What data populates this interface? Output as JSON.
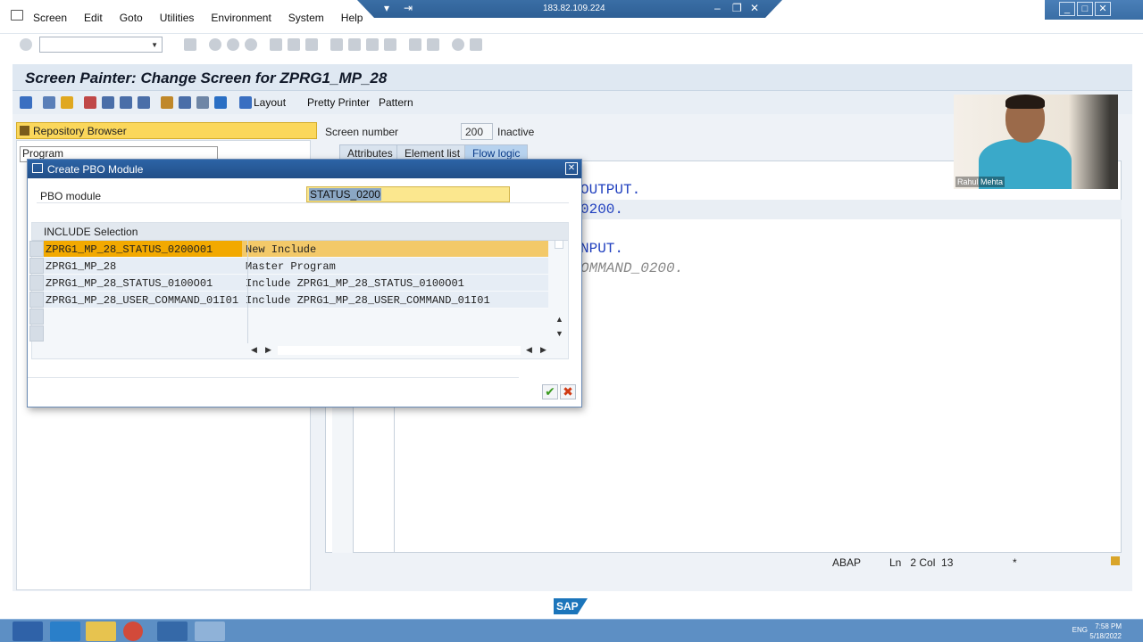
{
  "menubar": {
    "items": [
      "Screen",
      "Edit",
      "Goto",
      "Utilities",
      "Environment",
      "System",
      "Help"
    ]
  },
  "rdp": {
    "ip": "183.82.109.224"
  },
  "toolbar": {
    "command_field_value": ""
  },
  "title": "Screen Painter: Change Screen for ZPRG1_MP_28",
  "app_toolbar": {
    "layout_label": "Layout",
    "pretty_printer_label": "Pretty Printer",
    "pattern_label": "Pattern"
  },
  "left_panel": {
    "header": "Repository Browser",
    "object_type": "Program"
  },
  "screen_info": {
    "screen_number_label": "Screen number",
    "screen_number": "200",
    "status": "Inactive"
  },
  "tabs": [
    {
      "label": "Attributes",
      "active": false
    },
    {
      "label": "Element list",
      "active": false
    },
    {
      "label": "Flow logic",
      "active": true
    }
  ],
  "code_fragments": [
    "OUTPUT.",
    "0200.",
    "NPUT.",
    "OMMAND_0200."
  ],
  "status_bar": {
    "language": "ABAP",
    "position": "Ln   2 Col  13",
    "mode": "*"
  },
  "webcam": {
    "name": "Rahul Mehta"
  },
  "dialog": {
    "title": "Create PBO Module",
    "pbo_label": "PBO module",
    "pbo_value": "STATUS_0200",
    "grid_title": "INCLUDE Selection",
    "rows": [
      {
        "name": "ZPRG1_MP_28_STATUS_0200O01",
        "desc": "New Include",
        "selected": true
      },
      {
        "name": "ZPRG1_MP_28",
        "desc": "Master Program",
        "selected": false
      },
      {
        "name": "ZPRG1_MP_28_STATUS_0100O01",
        "desc": "Include ZPRG1_MP_28_STATUS_0100O01",
        "selected": false
      },
      {
        "name": "ZPRG1_MP_28_USER_COMMAND_01I01",
        "desc": "Include ZPRG1_MP_28_USER_COMMAND_01I01",
        "selected": false
      }
    ]
  },
  "sap_logo": "SAP",
  "taskbar": {
    "lang": "ENG",
    "time": "7:58 PM",
    "date": "5/18/2022"
  },
  "colors": {
    "title_band": "#dfe8f2",
    "repo_header": "#fbd75b",
    "selected_row": "#f2a900",
    "dialog_title": "#2c64a6",
    "code_blue": "#1f3fbf"
  }
}
